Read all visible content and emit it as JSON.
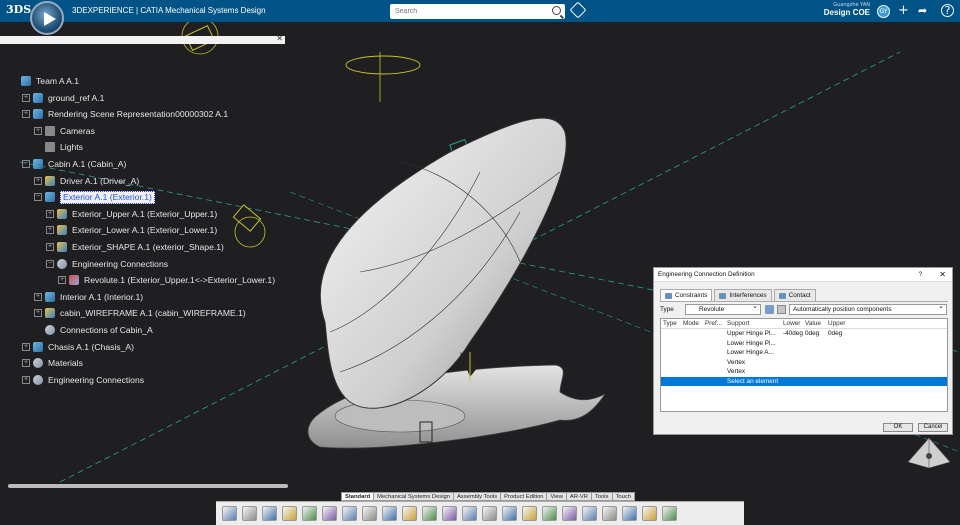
{
  "app": {
    "brand": "3DEXPERIENCE | CATIA",
    "brand_bold": "3D",
    "product": "Mechanical Systems Design",
    "user_name": "Guangzhe YAN",
    "collab_space": "Design COE",
    "avatar_initials": "GY"
  },
  "search": {
    "placeholder": "Search"
  },
  "tree": [
    {
      "label": "Team A A.1",
      "icon": "product-icon",
      "indent": 0,
      "expander": ""
    },
    {
      "label": "ground_ref A.1",
      "icon": "product-icon",
      "indent": 1,
      "expander": "+"
    },
    {
      "label": "Rendering Scene Representation00000302 A.1",
      "icon": "rendering-icon",
      "indent": 1,
      "expander": "+"
    },
    {
      "label": "Cameras",
      "icon": "folder-icon",
      "indent": 2,
      "expander": "+"
    },
    {
      "label": "Lights",
      "icon": "folder-icon",
      "indent": 2,
      "expander": ""
    },
    {
      "label": "Cabin A.1 (Cabin_A)",
      "icon": "product-icon",
      "indent": 1,
      "expander": "−"
    },
    {
      "label": "Driver A.1 (Driver_A)",
      "icon": "part-icon",
      "indent": 2,
      "expander": "+"
    },
    {
      "label": "Exterior A.1 (Exterior.1)",
      "icon": "product-icon",
      "indent": 2,
      "expander": "−",
      "selected": true
    },
    {
      "label": "Exterior_Upper A.1 (Exterior_Upper.1)",
      "icon": "part-icon",
      "indent": 3,
      "expander": "+"
    },
    {
      "label": "Exterior_Lower A.1 (Exterior_Lower.1)",
      "icon": "part-icon",
      "indent": 3,
      "expander": "+"
    },
    {
      "label": "Exterior_SHAPE A.1 (exterior_Shape.1)",
      "icon": "part-icon",
      "indent": 3,
      "expander": "+"
    },
    {
      "label": "Engineering Connections",
      "icon": "engineering-connections-icon",
      "indent": 3,
      "expander": "−"
    },
    {
      "label": "Revolute.1 (Exterior_Upper.1<->Exterior_Lower.1)",
      "icon": "revolute-icon",
      "indent": 4,
      "expander": "+"
    },
    {
      "label": "Interior A.1 (Interior.1)",
      "icon": "product-icon",
      "indent": 2,
      "expander": "+"
    },
    {
      "label": "cabin_WIREFRAME A.1 (cabin_WIREFRAME.1)",
      "icon": "part-icon",
      "indent": 2,
      "expander": "+"
    },
    {
      "label": "Connections of Cabin_A",
      "icon": "engineering-connections-icon",
      "indent": 2,
      "expander": ""
    },
    {
      "label": "Chasis A.1 (Chasis_A)",
      "icon": "product-icon",
      "indent": 1,
      "expander": "+"
    },
    {
      "label": "Materials",
      "icon": "materials-icon",
      "indent": 1,
      "expander": "+"
    },
    {
      "label": "Engineering Connections",
      "icon": "engineering-connections-icon",
      "indent": 1,
      "expander": "+"
    }
  ],
  "dialog": {
    "title": "Engineering Connection Definition",
    "help": "?",
    "close": "✕",
    "tabs": [
      "Constraints",
      "Interferences",
      "Contact"
    ],
    "type_label": "Type",
    "type_value": "Revolute",
    "position_mode": "Automatically position components",
    "headers": [
      "Type",
      "Mode",
      "Pref...",
      "Support",
      "Lower",
      "Value",
      "Upper"
    ],
    "rows": [
      {
        "support": "Upper Hinge Pl...",
        "lower": "-40deg",
        "value": "0deg",
        "upper": "0deg"
      },
      {
        "support": "Lower Hinge Pl...",
        "lower": "",
        "value": "",
        "upper": ""
      },
      {
        "support": "Lower Hinge A...",
        "lower": "",
        "value": "",
        "upper": ""
      },
      {
        "support": "Vertex",
        "lower": "",
        "value": "",
        "upper": ""
      },
      {
        "support": "Vertex",
        "lower": "",
        "value": "",
        "upper": ""
      },
      {
        "support": "Select an element",
        "lower": "",
        "value": "",
        "upper": "",
        "highlight": true
      }
    ],
    "ok": "OK",
    "cancel": "Cancel"
  },
  "toolbar_tabs": [
    "Standard",
    "Mechanical Systems Design",
    "Assembly Tools",
    "Product Edition",
    "View",
    "AR-VR",
    "Tools",
    "Touch"
  ],
  "active_toolbar_tab": "Standard",
  "toolbar_icons": [
    "cut-icon",
    "copy-icon",
    "paste-icon",
    "undo-icon",
    "update-icon",
    "search-icon",
    "cube-icon",
    "fit-all-icon",
    "pan-icon",
    "rotate-icon",
    "zoom-icon",
    "normal-view-icon",
    "multi-view-icon",
    "shading-icon",
    "render-icon",
    "hide-show-icon",
    "swap-icon",
    "cut-section-icon",
    "measure-icon",
    "explode-icon",
    "sectioning-icon",
    "tree-icon",
    "compass-icon"
  ]
}
